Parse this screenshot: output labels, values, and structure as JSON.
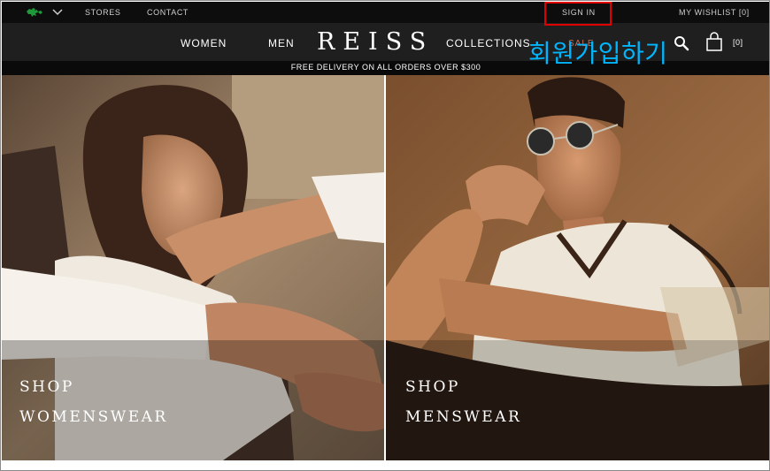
{
  "utility_bar": {
    "stores": "STORES",
    "contact": "CONTACT",
    "sign_in": "SIGN IN",
    "wishlist": "MY WISHLIST [0]"
  },
  "main_nav": {
    "logo": "REISS",
    "women": "WOMEN",
    "men": "MEN",
    "collections": "COLLECTIONS",
    "sale": "SALE",
    "bag_count": "[0]"
  },
  "annotation": {
    "korean_text": "회원가입하기",
    "color": "#00b7ff",
    "highlight_color": "#e10000"
  },
  "promo": {
    "text": "FREE DELIVERY ON ALL ORDERS OVER $300"
  },
  "hero": {
    "women": {
      "line1": "SHOP",
      "line2": "WOMENSWEAR"
    },
    "men": {
      "line1": "SHOP",
      "line2": "MENSWEAR"
    }
  },
  "icons": {
    "flag": "flag-icon",
    "chevron": "chevron-down-icon",
    "search": "search-icon",
    "bag": "shopping-bag-icon"
  }
}
